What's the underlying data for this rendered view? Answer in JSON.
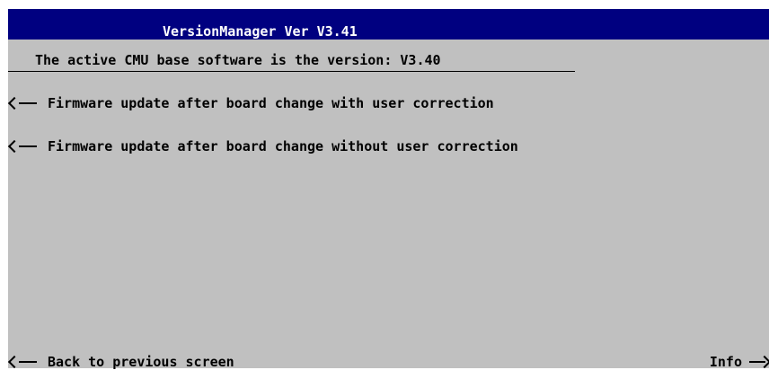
{
  "window": {
    "title": "VersionManager Ver V3.41"
  },
  "status": {
    "text": "The active CMU base software is the version: V3.40"
  },
  "softkeys": {
    "items": [
      {
        "label": "Firmware update after board change with user correction"
      },
      {
        "label": "Firmware update after board change without user correction"
      }
    ],
    "back_label": "Back to previous screen",
    "info_label": "Info"
  },
  "colors": {
    "title_bar": "#000080",
    "background": "#c0c0c0",
    "title_text": "#ffffff"
  },
  "icons": {
    "softkey_left": "arrow-left-icon",
    "softkey_right": "arrow-right-icon"
  }
}
